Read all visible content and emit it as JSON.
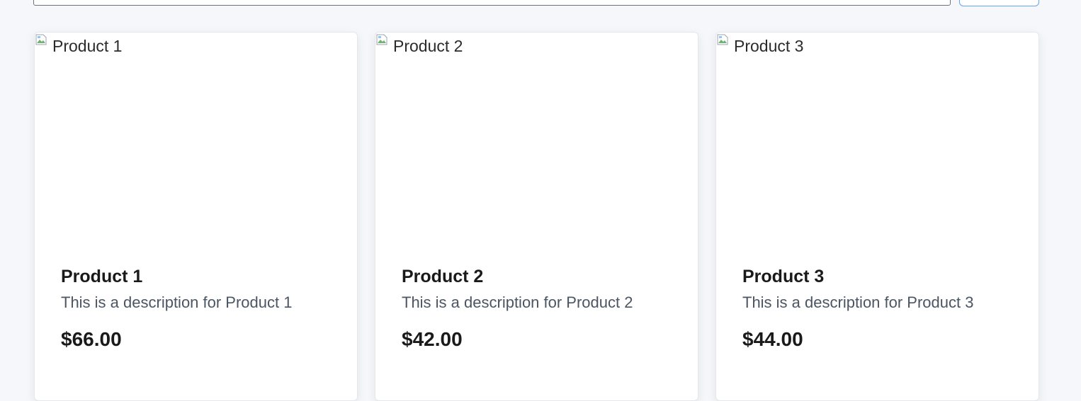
{
  "products": [
    {
      "image_alt": "Product 1",
      "title": "Product 1",
      "description": "This is a description for Product 1",
      "price": "$66.00"
    },
    {
      "image_alt": "Product 2",
      "title": "Product 2",
      "description": "This is a description for Product 2",
      "price": "$42.00"
    },
    {
      "image_alt": "Product 3",
      "title": "Product 3",
      "description": "This is a description for Product 3",
      "price": "$44.00"
    }
  ],
  "icons": {
    "broken_image": "broken-image-icon"
  }
}
